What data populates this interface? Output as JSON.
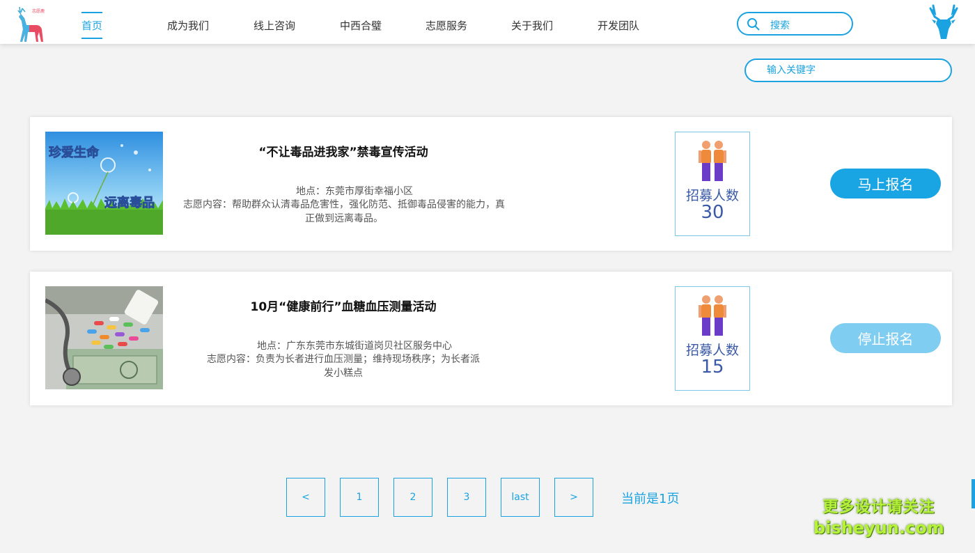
{
  "header": {
    "logo_text": "志愿鹿",
    "nav": [
      {
        "label": "首页",
        "active": true
      },
      {
        "label": "成为我们",
        "active": false
      },
      {
        "label": "线上咨询",
        "active": false
      },
      {
        "label": "中西合璧",
        "active": false
      },
      {
        "label": "志愿服务",
        "active": false
      },
      {
        "label": "关于我们",
        "active": false
      },
      {
        "label": "开发团队",
        "active": false
      }
    ],
    "search_label": "搜索",
    "brand_icon": "deer-head-icon"
  },
  "keyword": {
    "placeholder": "输入关键字"
  },
  "activities": [
    {
      "image_text_top": "珍爱生命",
      "image_text_bottom": "远离毒品",
      "title": "“不让毒品进我家”禁毒宣传活动",
      "place": "地点：东莞市厚街幸福小区",
      "desc": "志愿内容：帮助群众认清毒品危害性，强化防范、抵御毒品侵害的能力，真正做到远离毒品。",
      "recruit_label": "招募人数",
      "recruit_count": "30",
      "action_label": "马上报名",
      "action_color": "#19a4e3"
    },
    {
      "title": "10月“健康前行”血糖血压测量活动",
      "place": "地点：广东东莞市东城街道岗贝社区服务中心",
      "desc": "志愿内容：负责为长者进行血压测量；维持现场秩序；为长者派发小糕点",
      "recruit_label": "招募人数",
      "recruit_count": "15",
      "action_label": "停止报名",
      "action_color": "#7fcdf0"
    }
  ],
  "pagination": {
    "buttons": [
      "<",
      "1",
      "2",
      "3",
      "last",
      ">"
    ],
    "status": "当前是1页"
  },
  "watermark": {
    "line1": "更多设计请关注",
    "line2": "bisheyun.com"
  },
  "colors": {
    "accent": "#1aa3e0",
    "recruit_text": "#3a5aa8"
  }
}
